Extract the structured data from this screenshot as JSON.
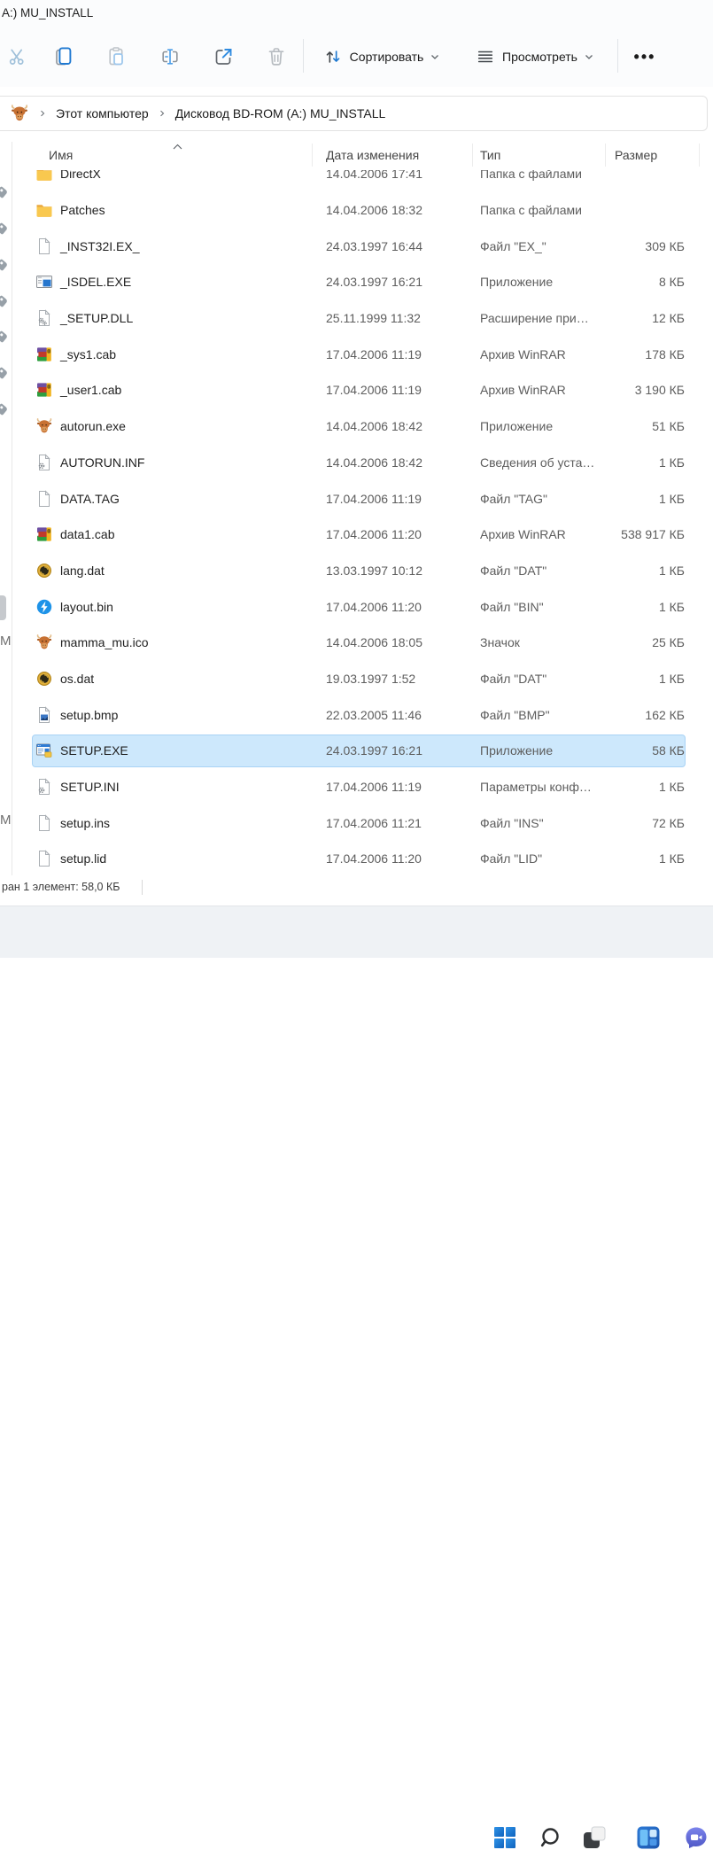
{
  "window": {
    "title": "A:) MU_INSTALL"
  },
  "toolbar": {
    "sort_label": "Сортировать",
    "view_label": "Просмотреть",
    "more_label": "•••",
    "icons": [
      "cut-icon",
      "copy-icon",
      "paste-icon",
      "rename-icon",
      "share-icon",
      "delete-icon",
      "sort-icon",
      "view-icon",
      "more-icon"
    ]
  },
  "breadcrumb": {
    "drive_icon": "cow-icon",
    "this_pc": "Этот компьютер",
    "drive": "Дисковод BD-ROM (A:) MU_INSTALL"
  },
  "columns": {
    "name": "Имя",
    "date": "Дата изменения",
    "type": "Тип",
    "size": "Размер",
    "sort_indicator": "ascending"
  },
  "files": {
    "rows": [
      {
        "name": "DirectX",
        "date": "14.04.2006 17:41",
        "type": "Папка с файлами",
        "size": "",
        "icon": "folder",
        "selected": false
      },
      {
        "name": "Patches",
        "date": "14.04.2006 18:32",
        "type": "Папка с файлами",
        "size": "",
        "icon": "folder",
        "selected": false
      },
      {
        "name": "_INST32I.EX_",
        "date": "24.03.1997 16:44",
        "type": "Файл \"EX_\"",
        "size": "309 КБ",
        "icon": "page",
        "selected": false
      },
      {
        "name": "_ISDEL.EXE",
        "date": "24.03.1997 16:21",
        "type": "Приложение",
        "size": "8 КБ",
        "icon": "appwin",
        "selected": false
      },
      {
        "name": "_SETUP.DLL",
        "date": "25.11.1999 11:32",
        "type": "Расширение при…",
        "size": "12 КБ",
        "icon": "gearpage2",
        "selected": false
      },
      {
        "name": "_sys1.cab",
        "date": "17.04.2006 11:19",
        "type": "Архив WinRAR",
        "size": "178 КБ",
        "icon": "winrar",
        "selected": false
      },
      {
        "name": "_user1.cab",
        "date": "17.04.2006 11:19",
        "type": "Архив WinRAR",
        "size": "3 190 КБ",
        "icon": "winrar",
        "selected": false
      },
      {
        "name": "autorun.exe",
        "date": "14.04.2006 18:42",
        "type": "Приложение",
        "size": "51 КБ",
        "icon": "cow",
        "selected": false
      },
      {
        "name": "AUTORUN.INF",
        "date": "14.04.2006 18:42",
        "type": "Сведения об уста…",
        "size": "1 КБ",
        "icon": "gearpage",
        "selected": false
      },
      {
        "name": "DATA.TAG",
        "date": "17.04.2006 11:19",
        "type": "Файл \"TAG\"",
        "size": "1 КБ",
        "icon": "page",
        "selected": false
      },
      {
        "name": "data1.cab",
        "date": "17.04.2006 11:20",
        "type": "Архив WinRAR",
        "size": "538 917 КБ",
        "icon": "winrar",
        "selected": false
      },
      {
        "name": "lang.dat",
        "date": "13.03.1997 10:12",
        "type": "Файл \"DAT\"",
        "size": "1 КБ",
        "icon": "shutter",
        "selected": false
      },
      {
        "name": "layout.bin",
        "date": "17.04.2006 11:20",
        "type": "Файл \"BIN\"",
        "size": "1 КБ",
        "icon": "bolt",
        "selected": false
      },
      {
        "name": "mamma_mu.ico",
        "date": "14.04.2006 18:05",
        "type": "Значок",
        "size": "25 КБ",
        "icon": "cow",
        "selected": false
      },
      {
        "name": "os.dat",
        "date": "19.03.1997 1:52",
        "type": "Файл \"DAT\"",
        "size": "1 КБ",
        "icon": "shutter",
        "selected": false
      },
      {
        "name": "setup.bmp",
        "date": "22.03.2005 11:46",
        "type": "Файл \"BMP\"",
        "size": "162 КБ",
        "icon": "imagepage",
        "selected": false
      },
      {
        "name": "SETUP.EXE",
        "date": "24.03.1997 16:21",
        "type": "Приложение",
        "size": "58 КБ",
        "icon": "setupapp",
        "selected": true
      },
      {
        "name": "SETUP.INI",
        "date": "17.04.2006 11:19",
        "type": "Параметры конф…",
        "size": "1 КБ",
        "icon": "gearpage",
        "selected": false
      },
      {
        "name": "setup.ins",
        "date": "17.04.2006 11:21",
        "type": "Файл \"INS\"",
        "size": "72 КБ",
        "icon": "page",
        "selected": false
      },
      {
        "name": "setup.lid",
        "date": "17.04.2006 11:20",
        "type": "Файл \"LID\"",
        "size": "1 КБ",
        "icon": "page",
        "selected": false
      }
    ]
  },
  "statusbar": {
    "text": "ран 1 элемент: 58,0 КБ"
  },
  "fragments": {
    "letter": "M"
  },
  "taskbar": {
    "items": [
      "start",
      "search",
      "task-view",
      "widgets",
      "chat"
    ]
  },
  "colors": {
    "accent": "#0b66c3",
    "selection_bg": "#cde8fc",
    "selection_border": "#a9d3f5",
    "taskbar_bg": "#eff2f5",
    "chrome_bg": "#fbfcfd"
  }
}
